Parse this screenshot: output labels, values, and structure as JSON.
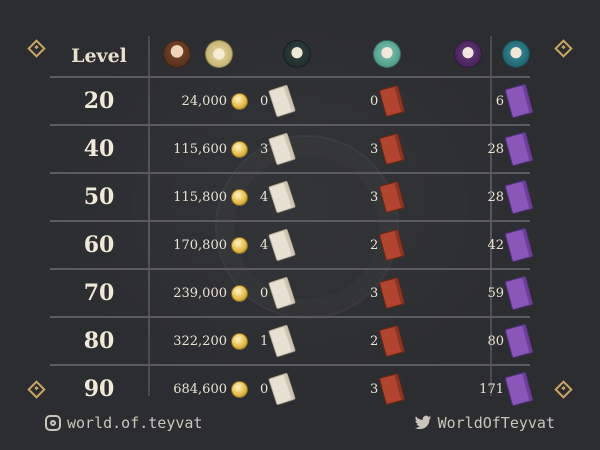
{
  "table": {
    "level_header": "Level",
    "rows": [
      {
        "level": "20",
        "mora": "24,000",
        "white": "0",
        "red": "0",
        "purple": "6"
      },
      {
        "level": "40",
        "mora": "115,600",
        "white": "3",
        "red": "3",
        "purple": "28"
      },
      {
        "level": "50",
        "mora": "115,800",
        "white": "4",
        "red": "3",
        "purple": "28"
      },
      {
        "level": "60",
        "mora": "170,800",
        "white": "4",
        "red": "2",
        "purple": "42"
      },
      {
        "level": "70",
        "mora": "239,000",
        "white": "0",
        "red": "3",
        "purple": "59"
      },
      {
        "level": "80",
        "mora": "322,200",
        "white": "1",
        "red": "2",
        "purple": "80"
      },
      {
        "level": "90",
        "mora": "684,600",
        "white": "0",
        "red": "3",
        "purple": "171"
      }
    ]
  },
  "header_icons": [
    "avatar-brown-hair-icon",
    "avatar-blonde-icon",
    "avatar-dark-teal-icon",
    "avatar-green-hair-icon",
    "avatar-purple-hair-icon",
    "avatar-teal-hair-icon"
  ],
  "colors": {
    "coin": "#e4bb4d",
    "white_book": "#e7e1d3",
    "red_book": "#b0442f",
    "purple_book": "#8a56b8",
    "accent": "#c9a664"
  },
  "footer": {
    "instagram": "world.of.teyvat",
    "twitter": "WorldOfTeyvat"
  }
}
